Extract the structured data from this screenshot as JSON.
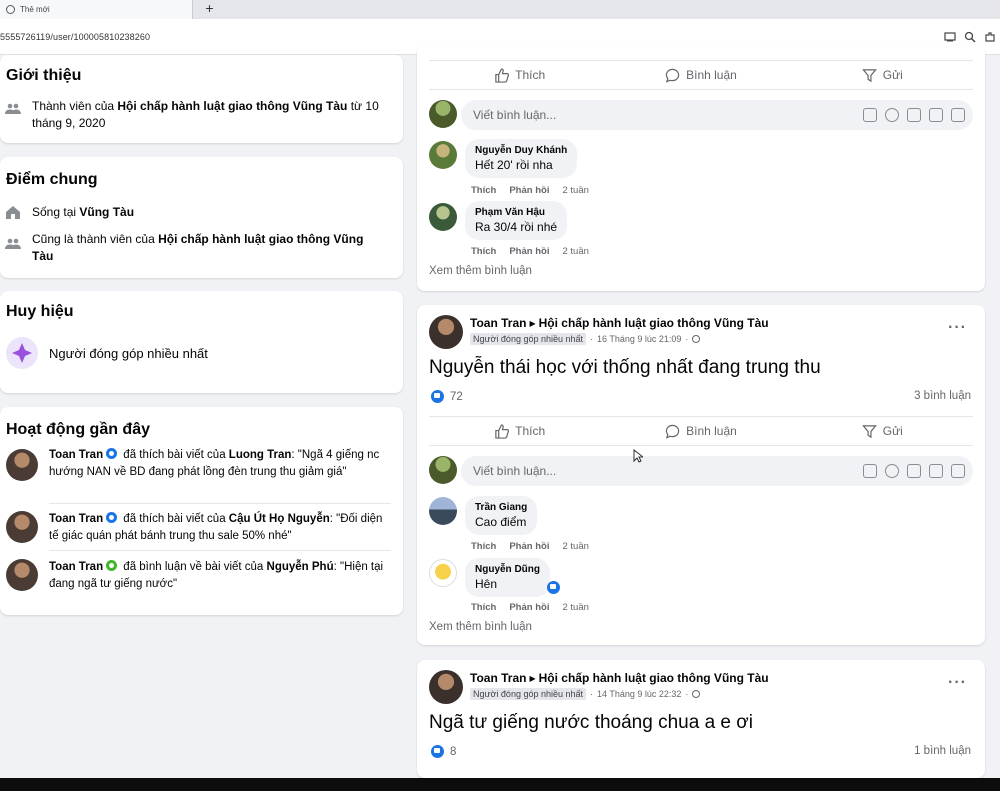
{
  "browser": {
    "tab_title": "Thẻ mới",
    "new_tab": "+",
    "url": "5555726119/user/100005810238260"
  },
  "intro": {
    "title": "Giới thiệu",
    "member_prefix": "Thành viên của ",
    "group_name": "Hội chấp hành luật giao thông Vũng Tàu",
    "member_suffix": " từ 10 tháng 9, 2020"
  },
  "common": {
    "title": "Điểm chung",
    "lives_prefix": "Sống tại ",
    "lives_place": "Vũng Tàu",
    "also_prefix": "Cũng là thành viên của ",
    "also_group": "Hội chấp hành luật giao thông Vũng Tàu"
  },
  "badges": {
    "title": "Huy hiệu",
    "badge_label": "Người đóng góp nhiều nhất"
  },
  "activity": {
    "title": "Hoạt động gần đây",
    "items": [
      {
        "user": "Toan Tran",
        "verb": " đã thích bài viết của ",
        "target": "Luong Tran",
        "quote": ": \"Ngã 4 giếng nc hướng NAN về BD đang phát lồng đèn trung thu giảm giá\""
      },
      {
        "user": "Toan Tran",
        "verb": " đã thích bài viết của ",
        "target": "Cậu Út Họ Nguyễn",
        "quote": ": \"Đối diện tế giác quán phát bánh trung thu sale 50% nhé\""
      },
      {
        "user": "Toan Tran",
        "verb": " đã bình luận về bài viết của ",
        "target": "Nguyễn Phú",
        "quote": ": \"Hiện tại đang ngã tư giếng nước\""
      }
    ]
  },
  "actions": {
    "like": "Thích",
    "comment": "Bình luận",
    "send": "Gửi"
  },
  "write_placeholder": "Viết bình luận...",
  "comment_meta": {
    "like": "Thích",
    "reply": "Phản hồi",
    "time": "2 tuần"
  },
  "see_more": "Xem thêm bình luận",
  "post0": {
    "comments": [
      {
        "name": "Nguyễn Duy Khánh",
        "text": "Hết 20' rồi nha"
      },
      {
        "name": "Phạm Văn Hậu",
        "text": "Ra 30/4 rồi nhé"
      }
    ]
  },
  "post1": {
    "author": "Toan Tran",
    "group": "Hội chấp hành luật giao thông Vũng Tàu",
    "badge": "Người đóng góp nhiều nhất",
    "time": "16 Tháng 9 lúc 21:09",
    "text": "Nguyễn thái học với thống nhất đang trung thu",
    "likes": "72",
    "comments_count": "3 bình luận",
    "comments": [
      {
        "name": "Trần Giang",
        "text": "Cao điểm"
      },
      {
        "name": "Nguyễn Dũng",
        "text": "Hên"
      }
    ]
  },
  "post2": {
    "author": "Toan Tran",
    "group": "Hội chấp hành luật giao thông Vũng Tàu",
    "badge": "Người đóng góp nhiều nhất",
    "time": "14 Tháng 9 lúc 22:32",
    "text": "Ngã tư giếng nước thoáng chua a e ơi",
    "likes": "8",
    "comments_count": "1 bình luận"
  }
}
